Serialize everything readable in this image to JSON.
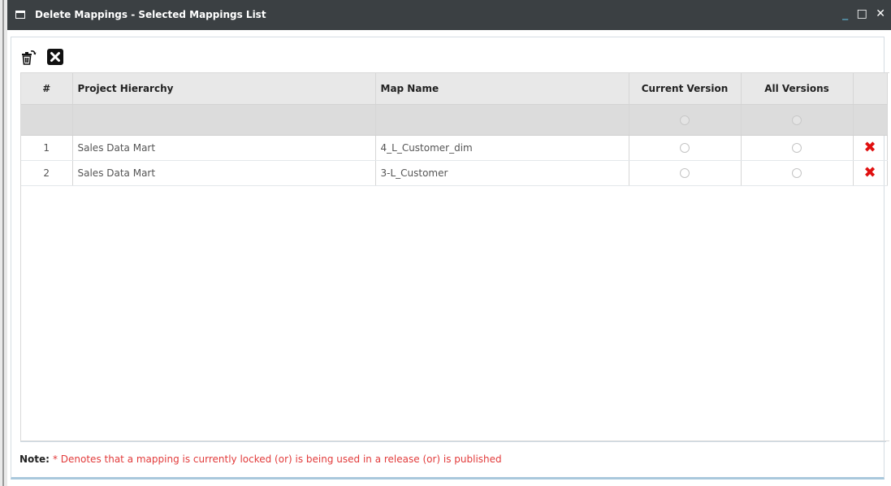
{
  "window": {
    "title": "Delete Mappings - Selected Mappings List",
    "controls": {
      "minimize": "_",
      "maximize": "□",
      "close": "✕"
    }
  },
  "toolbar": {
    "delete_icon": "trash-refresh-icon",
    "close_icon": "close-x-icon"
  },
  "grid": {
    "columns": [
      "#",
      "Project Hierarchy",
      "Map Name",
      "Current Version",
      "All Versions",
      ""
    ],
    "rows": [
      {
        "num": "1",
        "project": "Sales Data Mart",
        "map": "4_L_Customer_dim"
      },
      {
        "num": "2",
        "project": "Sales Data Mart",
        "map": "3-L_Customer"
      }
    ]
  },
  "note": {
    "label": "Note:",
    "text": "* Denotes that a mapping is currently locked (or) is being used in a release (or) is published"
  },
  "colors": {
    "titlebar": "#3b4043",
    "note_text": "#e23b3b",
    "delete_mark": "#e01010"
  }
}
